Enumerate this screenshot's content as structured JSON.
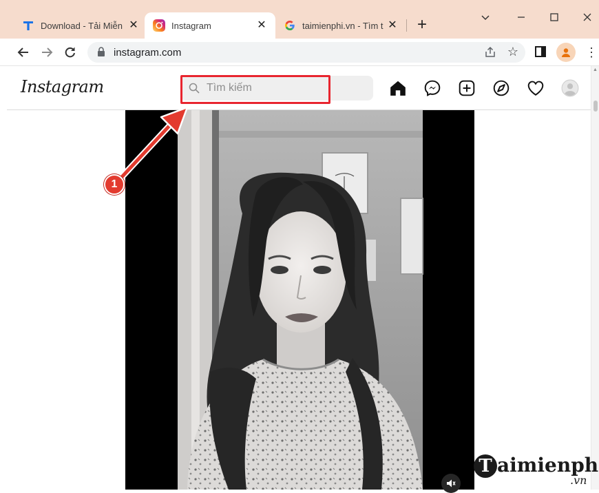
{
  "browser": {
    "tabs": [
      {
        "title": "Download - Tải Miễn",
        "favicon": "taimienphi-t-icon"
      },
      {
        "title": "Instagram",
        "favicon": "instagram-icon"
      },
      {
        "title": "taimienphi.vn - Tìm t",
        "favicon": "google-g-icon"
      }
    ],
    "new_tab_label": "+",
    "url": "instagram.com"
  },
  "instagram": {
    "logo": "Instagram",
    "search": {
      "placeholder": "Tìm kiếm",
      "value": ""
    },
    "nav_icons": [
      "home-icon",
      "messenger-icon",
      "new-post-icon",
      "explore-icon",
      "activity-heart-icon",
      "profile-avatar-icon"
    ]
  },
  "annotation": {
    "step": "1",
    "color": "#e33b2f"
  },
  "watermark": {
    "brand": "aimienphi",
    "initial": "T",
    "suffix": ".vn"
  },
  "colors": {
    "tabstrip": "#f6dccd",
    "highlight": "#e8252f",
    "accent": "#e33b2f"
  }
}
